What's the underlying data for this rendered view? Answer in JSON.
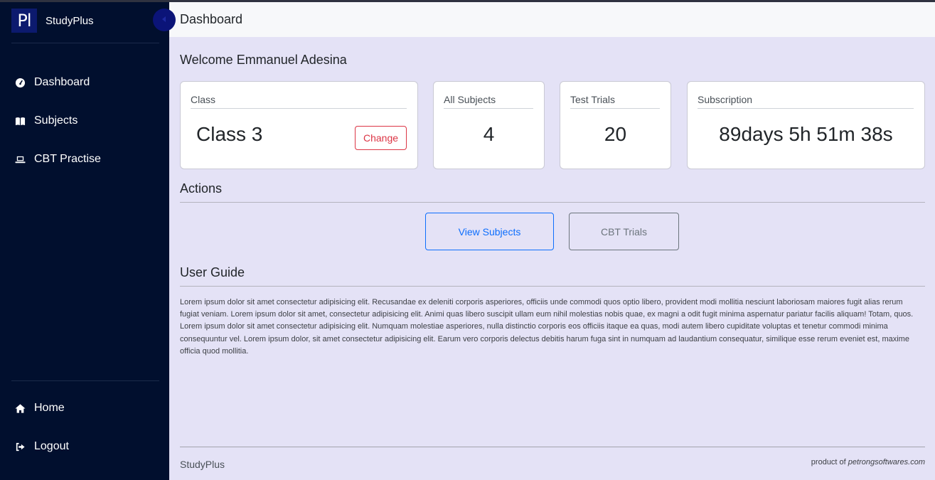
{
  "brand": {
    "logo_text": "Pl",
    "name": "StudyPlus"
  },
  "sidebar": {
    "items": [
      {
        "label": "Dashboard",
        "icon": "gauge-icon"
      },
      {
        "label": "Subjects",
        "icon": "book-icon"
      },
      {
        "label": "CBT Practise",
        "icon": "laptop-icon"
      }
    ],
    "bottom_items": [
      {
        "label": "Home",
        "icon": "home-icon"
      },
      {
        "label": "Logout",
        "icon": "logout-icon"
      }
    ]
  },
  "header": {
    "title": "Dashboard"
  },
  "welcome": "Welcome Emmanuel Adesina",
  "stats": {
    "class": {
      "label": "Class",
      "value": "Class 3",
      "change_label": "Change"
    },
    "subjects": {
      "label": "All Subjects",
      "value": "4"
    },
    "trials": {
      "label": "Test Trials",
      "value": "20"
    },
    "subscription": {
      "label": "Subscription",
      "value": "89days 5h 51m 38s"
    }
  },
  "actions": {
    "title": "Actions",
    "view_subjects": "View Subjects",
    "cbt_trials": "CBT Trials"
  },
  "guide": {
    "title": "User Guide",
    "text": "Lorem ipsum dolor sit amet consectetur adipisicing elit. Recusandae ex deleniti corporis asperiores, officiis unde commodi quos optio libero, provident modi mollitia nesciunt laboriosam maiores fugit alias rerum fugiat veniam. Lorem ipsum dolor sit amet, consectetur adipisicing elit. Animi quas libero suscipit ullam eum nihil molestias nobis quae, ex magni a odit fugit minima aspernatur pariatur facilis aliquam! Totam, quos. Lorem ipsum dolor sit amet consectetur adipisicing elit. Numquam molestiae asperiores, nulla distinctio corporis eos officiis itaque ea quas, modi autem libero cupiditate voluptas et tenetur commodi minima consequuntur vel. Lorem ipsum dolor, sit amet consectetur adipisicing elit. Earum vero corporis delectus debitis harum fuga sint in numquam ad laudantium consequatur, similique esse rerum eveniet est, maxime officia quod mollitia."
  },
  "footer": {
    "brand": "StudyPlus",
    "credit_prefix": "product of",
    "credit_site": "petrongsoftwares.com"
  },
  "colors": {
    "sidebar_bg": "#010f2e",
    "content_bg": "#e4e2f6",
    "logo_bg": "#0c1a6e",
    "primary": "#0d6efd",
    "danger": "#dc3545",
    "secondary": "#6c757d"
  }
}
